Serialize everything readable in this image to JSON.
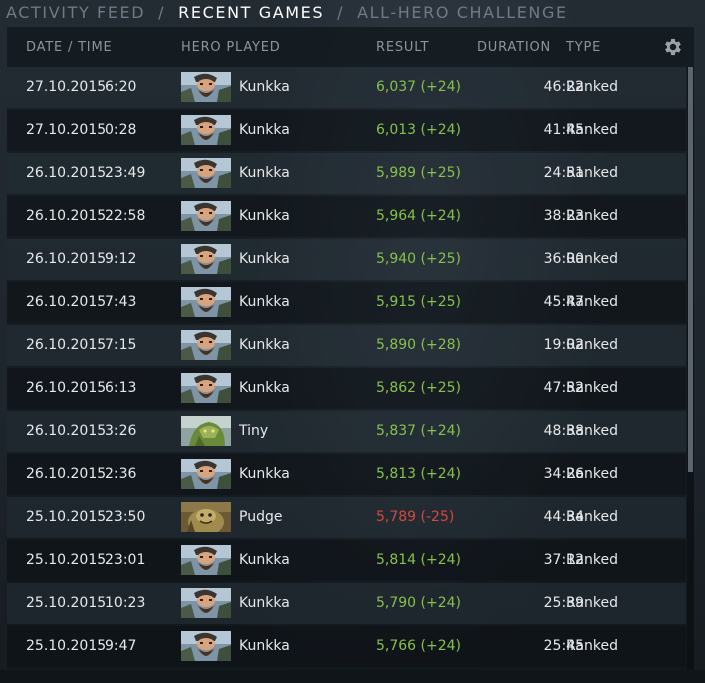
{
  "tabs": [
    {
      "label": "ACTIVITY FEED",
      "active": false
    },
    {
      "label": "RECENT GAMES",
      "active": true
    },
    {
      "label": "ALL-HERO CHALLENGE",
      "active": false
    }
  ],
  "tab_separator": "/",
  "columns": {
    "date_time": "DATE / TIME",
    "hero": "HERO PLAYED",
    "result": "RESULT",
    "duration": "DURATION",
    "type": "TYPE"
  },
  "settings_icon": "gear-icon",
  "colors": {
    "win": "#86c14a",
    "loss": "#d6473e",
    "active_tab": "#ffffff",
    "inactive_tab": "#6f7a84"
  },
  "rows": [
    {
      "date": "27.10.2015",
      "time": "6:20",
      "hero": "Kunkka",
      "result": "6,037 (+24)",
      "outcome": "win",
      "duration": "46:22",
      "type": "Ranked"
    },
    {
      "date": "27.10.2015",
      "time": "0:28",
      "hero": "Kunkka",
      "result": "6,013 (+24)",
      "outcome": "win",
      "duration": "41:45",
      "type": "Ranked"
    },
    {
      "date": "26.10.2015",
      "time": "23:49",
      "hero": "Kunkka",
      "result": "5,989 (+25)",
      "outcome": "win",
      "duration": "24:51",
      "type": "Ranked"
    },
    {
      "date": "26.10.2015",
      "time": "22:58",
      "hero": "Kunkka",
      "result": "5,964 (+24)",
      "outcome": "win",
      "duration": "38:23",
      "type": "Ranked"
    },
    {
      "date": "26.10.2015",
      "time": "9:12",
      "hero": "Kunkka",
      "result": "5,940 (+25)",
      "outcome": "win",
      "duration": "36:00",
      "type": "Ranked"
    },
    {
      "date": "26.10.2015",
      "time": "7:43",
      "hero": "Kunkka",
      "result": "5,915 (+25)",
      "outcome": "win",
      "duration": "45:47",
      "type": "Ranked"
    },
    {
      "date": "26.10.2015",
      "time": "7:15",
      "hero": "Kunkka",
      "result": "5,890 (+28)",
      "outcome": "win",
      "duration": "19:02",
      "type": "Ranked"
    },
    {
      "date": "26.10.2015",
      "time": "6:13",
      "hero": "Kunkka",
      "result": "5,862 (+25)",
      "outcome": "win",
      "duration": "47:52",
      "type": "Ranked"
    },
    {
      "date": "26.10.2015",
      "time": "3:26",
      "hero": "Tiny",
      "result": "5,837 (+24)",
      "outcome": "win",
      "duration": "48:38",
      "type": "Ranked"
    },
    {
      "date": "26.10.2015",
      "time": "2:36",
      "hero": "Kunkka",
      "result": "5,813 (+24)",
      "outcome": "win",
      "duration": "34:26",
      "type": "Ranked"
    },
    {
      "date": "25.10.2015",
      "time": "23:50",
      "hero": "Pudge",
      "result": "5,789 (-25)",
      "outcome": "loss",
      "duration": "44:34",
      "type": "Ranked"
    },
    {
      "date": "25.10.2015",
      "time": "23:01",
      "hero": "Kunkka",
      "result": "5,814 (+24)",
      "outcome": "win",
      "duration": "37:12",
      "type": "Ranked"
    },
    {
      "date": "25.10.2015",
      "time": "10:23",
      "hero": "Kunkka",
      "result": "5,790 (+24)",
      "outcome": "win",
      "duration": "25:39",
      "type": "Ranked"
    },
    {
      "date": "25.10.2015",
      "time": "9:47",
      "hero": "Kunkka",
      "result": "5,766 (+24)",
      "outcome": "win",
      "duration": "25:45",
      "type": "Ranked"
    }
  ]
}
